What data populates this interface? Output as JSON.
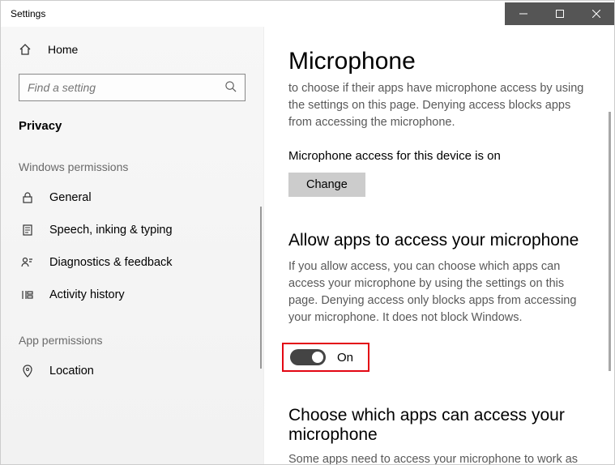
{
  "window": {
    "title": "Settings"
  },
  "sidebar": {
    "home": "Home",
    "search_placeholder": "Find a setting",
    "category": "Privacy",
    "group1": "Windows permissions",
    "group2": "App permissions",
    "items": [
      {
        "label": "General"
      },
      {
        "label": "Speech, inking & typing"
      },
      {
        "label": "Diagnostics & feedback"
      },
      {
        "label": "Activity history"
      }
    ],
    "app_items": [
      {
        "label": "Location"
      }
    ]
  },
  "content": {
    "title": "Microphone",
    "intro_cut": "to choose if their apps have microphone access by using the settings on this page. Denying access blocks apps from accessing the microphone.",
    "status": "Microphone access for this device is on",
    "change": "Change",
    "h2a": "Allow apps to access your microphone",
    "desc2": "If you allow access, you can choose which apps can access your microphone by using the settings on this page. Denying access only blocks apps from accessing your microphone. It does not block Windows.",
    "toggle_state": "On",
    "h2b": "Choose which apps can access your microphone",
    "tail": "Some apps need to access your microphone to work as"
  }
}
